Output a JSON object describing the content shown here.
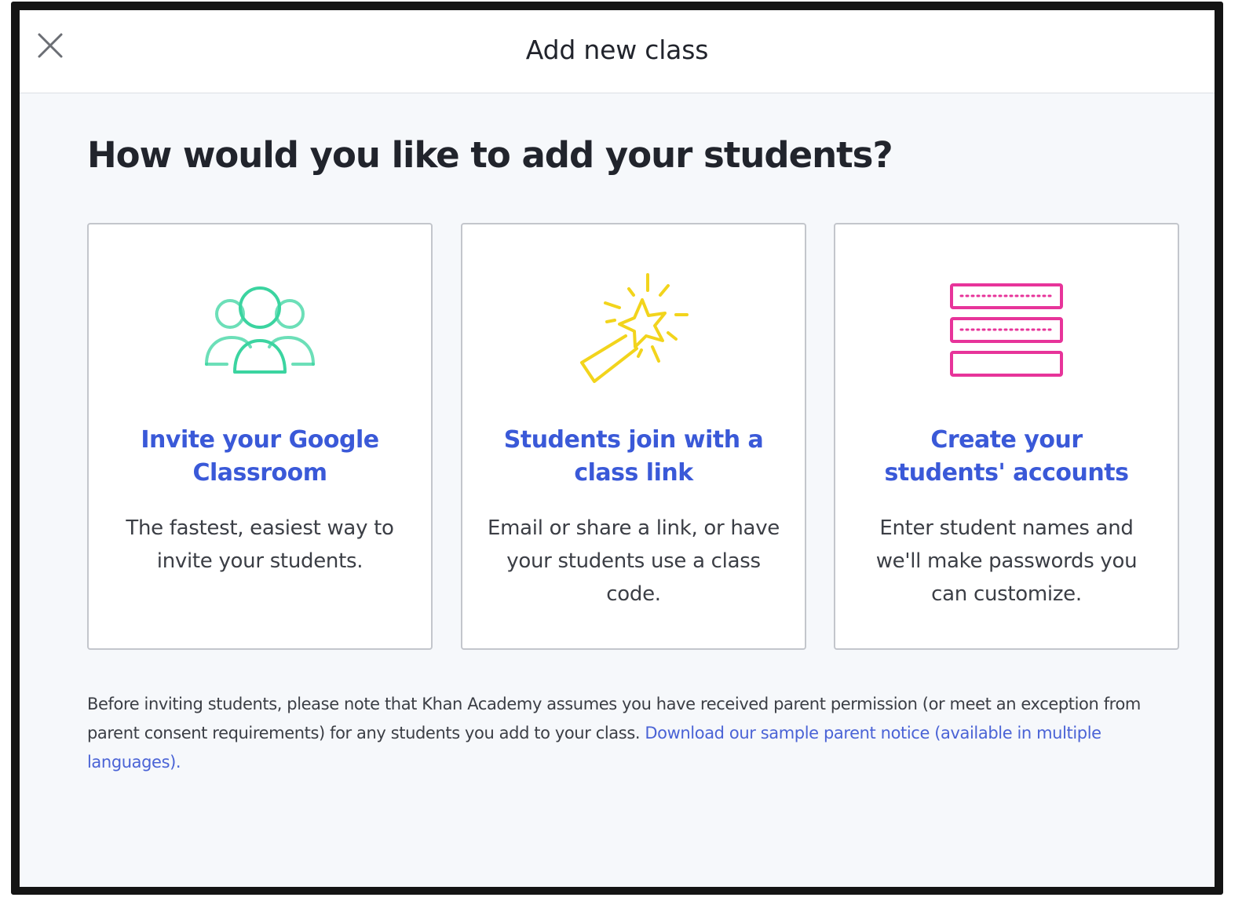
{
  "header": {
    "title": "Add new class",
    "close_icon": "close-icon"
  },
  "main": {
    "question": "How would you like to add your students?",
    "options": [
      {
        "icon": "group-people-icon",
        "title": "Invite your Google Classroom",
        "description": "The fastest, easiest way to invite your students."
      },
      {
        "icon": "magic-wand-icon",
        "title": "Students join with a class link",
        "description": "Email or share a link, or have your students use a class code."
      },
      {
        "icon": "password-fields-icon",
        "title": "Create your students' accounts",
        "description": "Enter student names and we'll make passwords you can customize."
      }
    ],
    "notice": {
      "text": "Before inviting students, please note that Khan Academy assumes you have received parent permission (or meet an exception from parent consent requirements) for any students you add to your class. ",
      "link": "Download our sample parent notice (available in multiple languages)."
    }
  },
  "colors": {
    "accent": "#3a59d8",
    "google_icon": "#3bd4a0",
    "wand_icon": "#f2d41c",
    "accounts_icon": "#e7349a"
  }
}
